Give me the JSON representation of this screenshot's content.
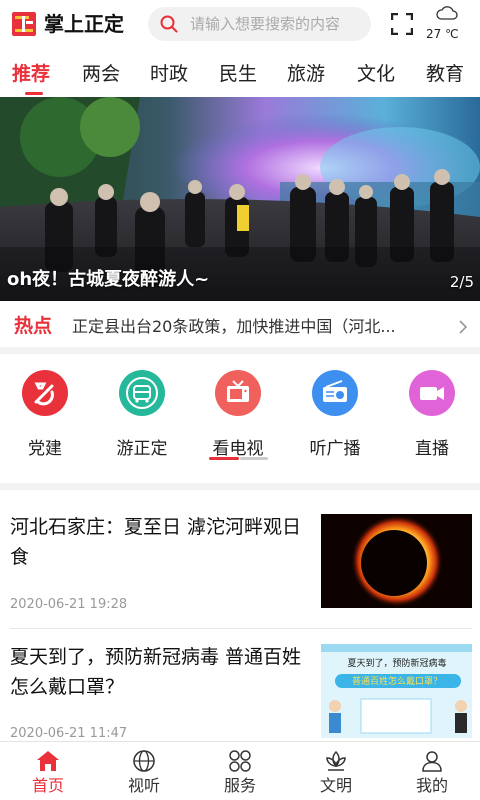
{
  "header": {
    "app_title": "掌上正定",
    "search_placeholder": "请输入想要搜索的内容",
    "weather": {
      "icon": "cloud-icon",
      "temperature": "27 ℃"
    }
  },
  "tabs": [
    {
      "label": "推荐",
      "active": true
    },
    {
      "label": "两会"
    },
    {
      "label": "时政"
    },
    {
      "label": "民生"
    },
    {
      "label": "旅游"
    },
    {
      "label": "文化"
    },
    {
      "label": "教育"
    }
  ],
  "banner": {
    "caption": "oh夜！古城夏夜醉游人~",
    "page_indicator": "2/5"
  },
  "hot_news": {
    "label": "热点",
    "text": "正定县出台20条政策，加快推进中国（河北..."
  },
  "shortcuts": [
    {
      "label": "党建",
      "icon": "party-emblem-icon",
      "color": "#e8313a"
    },
    {
      "label": "游正定",
      "icon": "tour-bus-icon",
      "color": "#26b89a"
    },
    {
      "label": "看电视",
      "icon": "tv-icon",
      "color": "#f0605c"
    },
    {
      "label": "听广播",
      "icon": "radio-icon",
      "color": "#3d8ff0"
    },
    {
      "label": "直播",
      "icon": "video-camera-icon",
      "color": "#e064d8"
    }
  ],
  "articles": [
    {
      "title": "河北石家庄：夏至日 滹沱河畔观日食",
      "date": "2020-06-21 19:28",
      "thumb": "solar-eclipse"
    },
    {
      "title": "夏天到了，预防新冠病毒 普通百姓怎么戴口罩？",
      "date": "2020-06-21 11:47",
      "thumb": "mask-poster",
      "thumb_text": {
        "line1": "夏天到了，预防新冠病毒",
        "line2": "普通百姓怎么戴口罩？"
      }
    }
  ],
  "bottom_nav": [
    {
      "label": "首页",
      "icon": "home-icon",
      "active": true
    },
    {
      "label": "视听",
      "icon": "globe-icon"
    },
    {
      "label": "服务",
      "icon": "grid-icon"
    },
    {
      "label": "文明",
      "icon": "lotus-icon"
    },
    {
      "label": "我的",
      "icon": "person-icon"
    }
  ],
  "colors": {
    "accent": "#e8313a"
  }
}
